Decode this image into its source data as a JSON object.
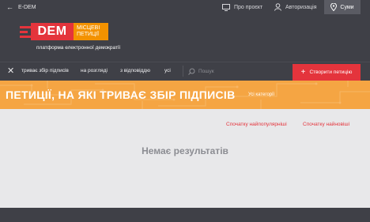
{
  "topbar": {
    "back_label": "E-DEM",
    "about_label": "Про проєкт",
    "auth_label": "Авторизація",
    "city_label": "Суми"
  },
  "brand": {
    "logo_text": "DEM",
    "logo_line1": "МІСЦЕВІ",
    "logo_line2": "ПЕТИЦІЇ",
    "tagline": "платформа електронної демократії"
  },
  "nav": {
    "items": [
      {
        "label": "триває збір підписів"
      },
      {
        "label": "на розгляді"
      },
      {
        "label": "з відповіддю"
      },
      {
        "label": "усі"
      }
    ],
    "search_placeholder": "Пошук",
    "create_label": "Створити петицію"
  },
  "page": {
    "title": "ПЕТИЦІЇ, НА ЯКІ ТРИВАЄ ЗБІР ПІДПИСІВ",
    "category": "Усі категорії"
  },
  "sort": {
    "popular_label": "Спочатку найпопулярніші",
    "newest_label": "Спочатку найновіші"
  },
  "empty_message": "Немає результатів",
  "colors": {
    "dark": "#3f4047",
    "red": "#e4343c",
    "orange": "#f5a543",
    "logo_orange": "#f39200",
    "content_bg": "#e8e8ea"
  }
}
